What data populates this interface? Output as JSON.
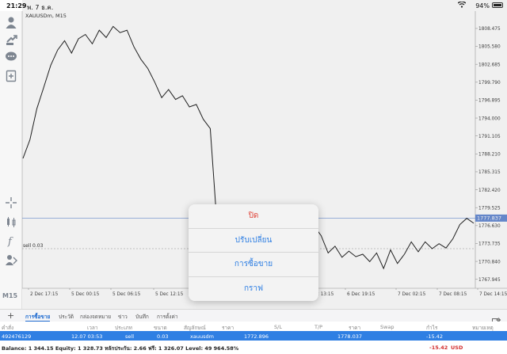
{
  "status_bar": {
    "time": "21:29",
    "date": "พ. 7 ธ.ค.",
    "battery": "94%"
  },
  "chart": {
    "symbol_label": "XAUUSDm, M15",
    "timeframe": "M15",
    "sell_label": "sell 0.03",
    "current_price": "1777.837",
    "price_ticks": [
      "1808.475",
      "1805.580",
      "1802.685",
      "1799.790",
      "1796.895",
      "1794.000",
      "1791.105",
      "1788.210",
      "1785.315",
      "1782.420",
      "1779.525",
      "1776.630",
      "1773.735",
      "1770.840",
      "1767.945"
    ],
    "time_ticks": [
      "2 Dec 17:15",
      "5 Dec 00:15",
      "5 Dec 06:15",
      "5 Dec 12:15",
      "6 Dec 13:15",
      "6 Dec 19:15",
      "7 Dec 02:15",
      "7 Dec 08:15",
      "7 Dec 14:15"
    ],
    "line_color": "#222222",
    "price_line_color": "#6b8fd6"
  },
  "chart_data": {
    "type": "line",
    "symbol": "XAUUSDm",
    "timeframe": "M15",
    "ylim": [
      1766.5,
      1810.0
    ],
    "series": [
      {
        "values": [
          1787.5,
          1790.5,
          1795.5,
          1799.0,
          1802.5,
          1805.0,
          1806.5,
          1804.5,
          1806.8,
          1807.5,
          1806.0,
          1808.2,
          1807.0,
          1808.8,
          1807.8,
          1808.2,
          1805.5,
          1803.5,
          1802.0,
          1799.8,
          1797.3,
          1798.6,
          1797.0,
          1797.6,
          1795.8,
          1796.2,
          1793.8,
          1792.3,
          1776.5,
          1778.0,
          1773.0,
          1770.5,
          1768.8,
          1770.0,
          1768.2,
          1769.5,
          1768.0,
          1770.2,
          1775.0,
          1779.8,
          1778.0,
          1779.2,
          1776.5,
          1775.0,
          1772.2,
          1773.3,
          1771.5,
          1772.5,
          1771.6,
          1772.0,
          1770.8,
          1772.2,
          1769.7,
          1772.7,
          1770.5,
          1772.0,
          1774.0,
          1772.4,
          1774.0,
          1772.9,
          1773.7,
          1773.0,
          1774.5,
          1776.8,
          1777.8,
          1777.0
        ]
      }
    ]
  },
  "menu": {
    "close": "ปิด",
    "modify": "ปรับเปลี่ยน",
    "trade": "การซื้อขาย",
    "chart": "กราฟ"
  },
  "tabs": [
    "การซื้อขาย",
    "ประวัติ",
    "กล่องจดหมาย",
    "ข่าว",
    "บันทึก",
    "การตั้งค่า"
  ],
  "columns": [
    "คำสั่ง",
    "เวลา",
    "ประเภท",
    "ขนาด",
    "สัญลักษณ์",
    "ราคา",
    "S/L",
    "T/P",
    "ราคา",
    "Swap",
    "กำไร",
    "หมายเหตุ"
  ],
  "order": {
    "ticket": "492476129",
    "time": "12.07 03:53",
    "type": "sell",
    "size": "0.03",
    "symbol": "xauusdm",
    "open_price": "1772.896",
    "current_price": "1778.037",
    "profit": "-15.42"
  },
  "balance": {
    "text": "Balance: 1 344.15 Equity: 1 328.73 หลักประกัน: 2.66 ฟรี: 1 326.07 Level: 49 964.58%",
    "profit": "-15.42",
    "currency": "USD"
  }
}
